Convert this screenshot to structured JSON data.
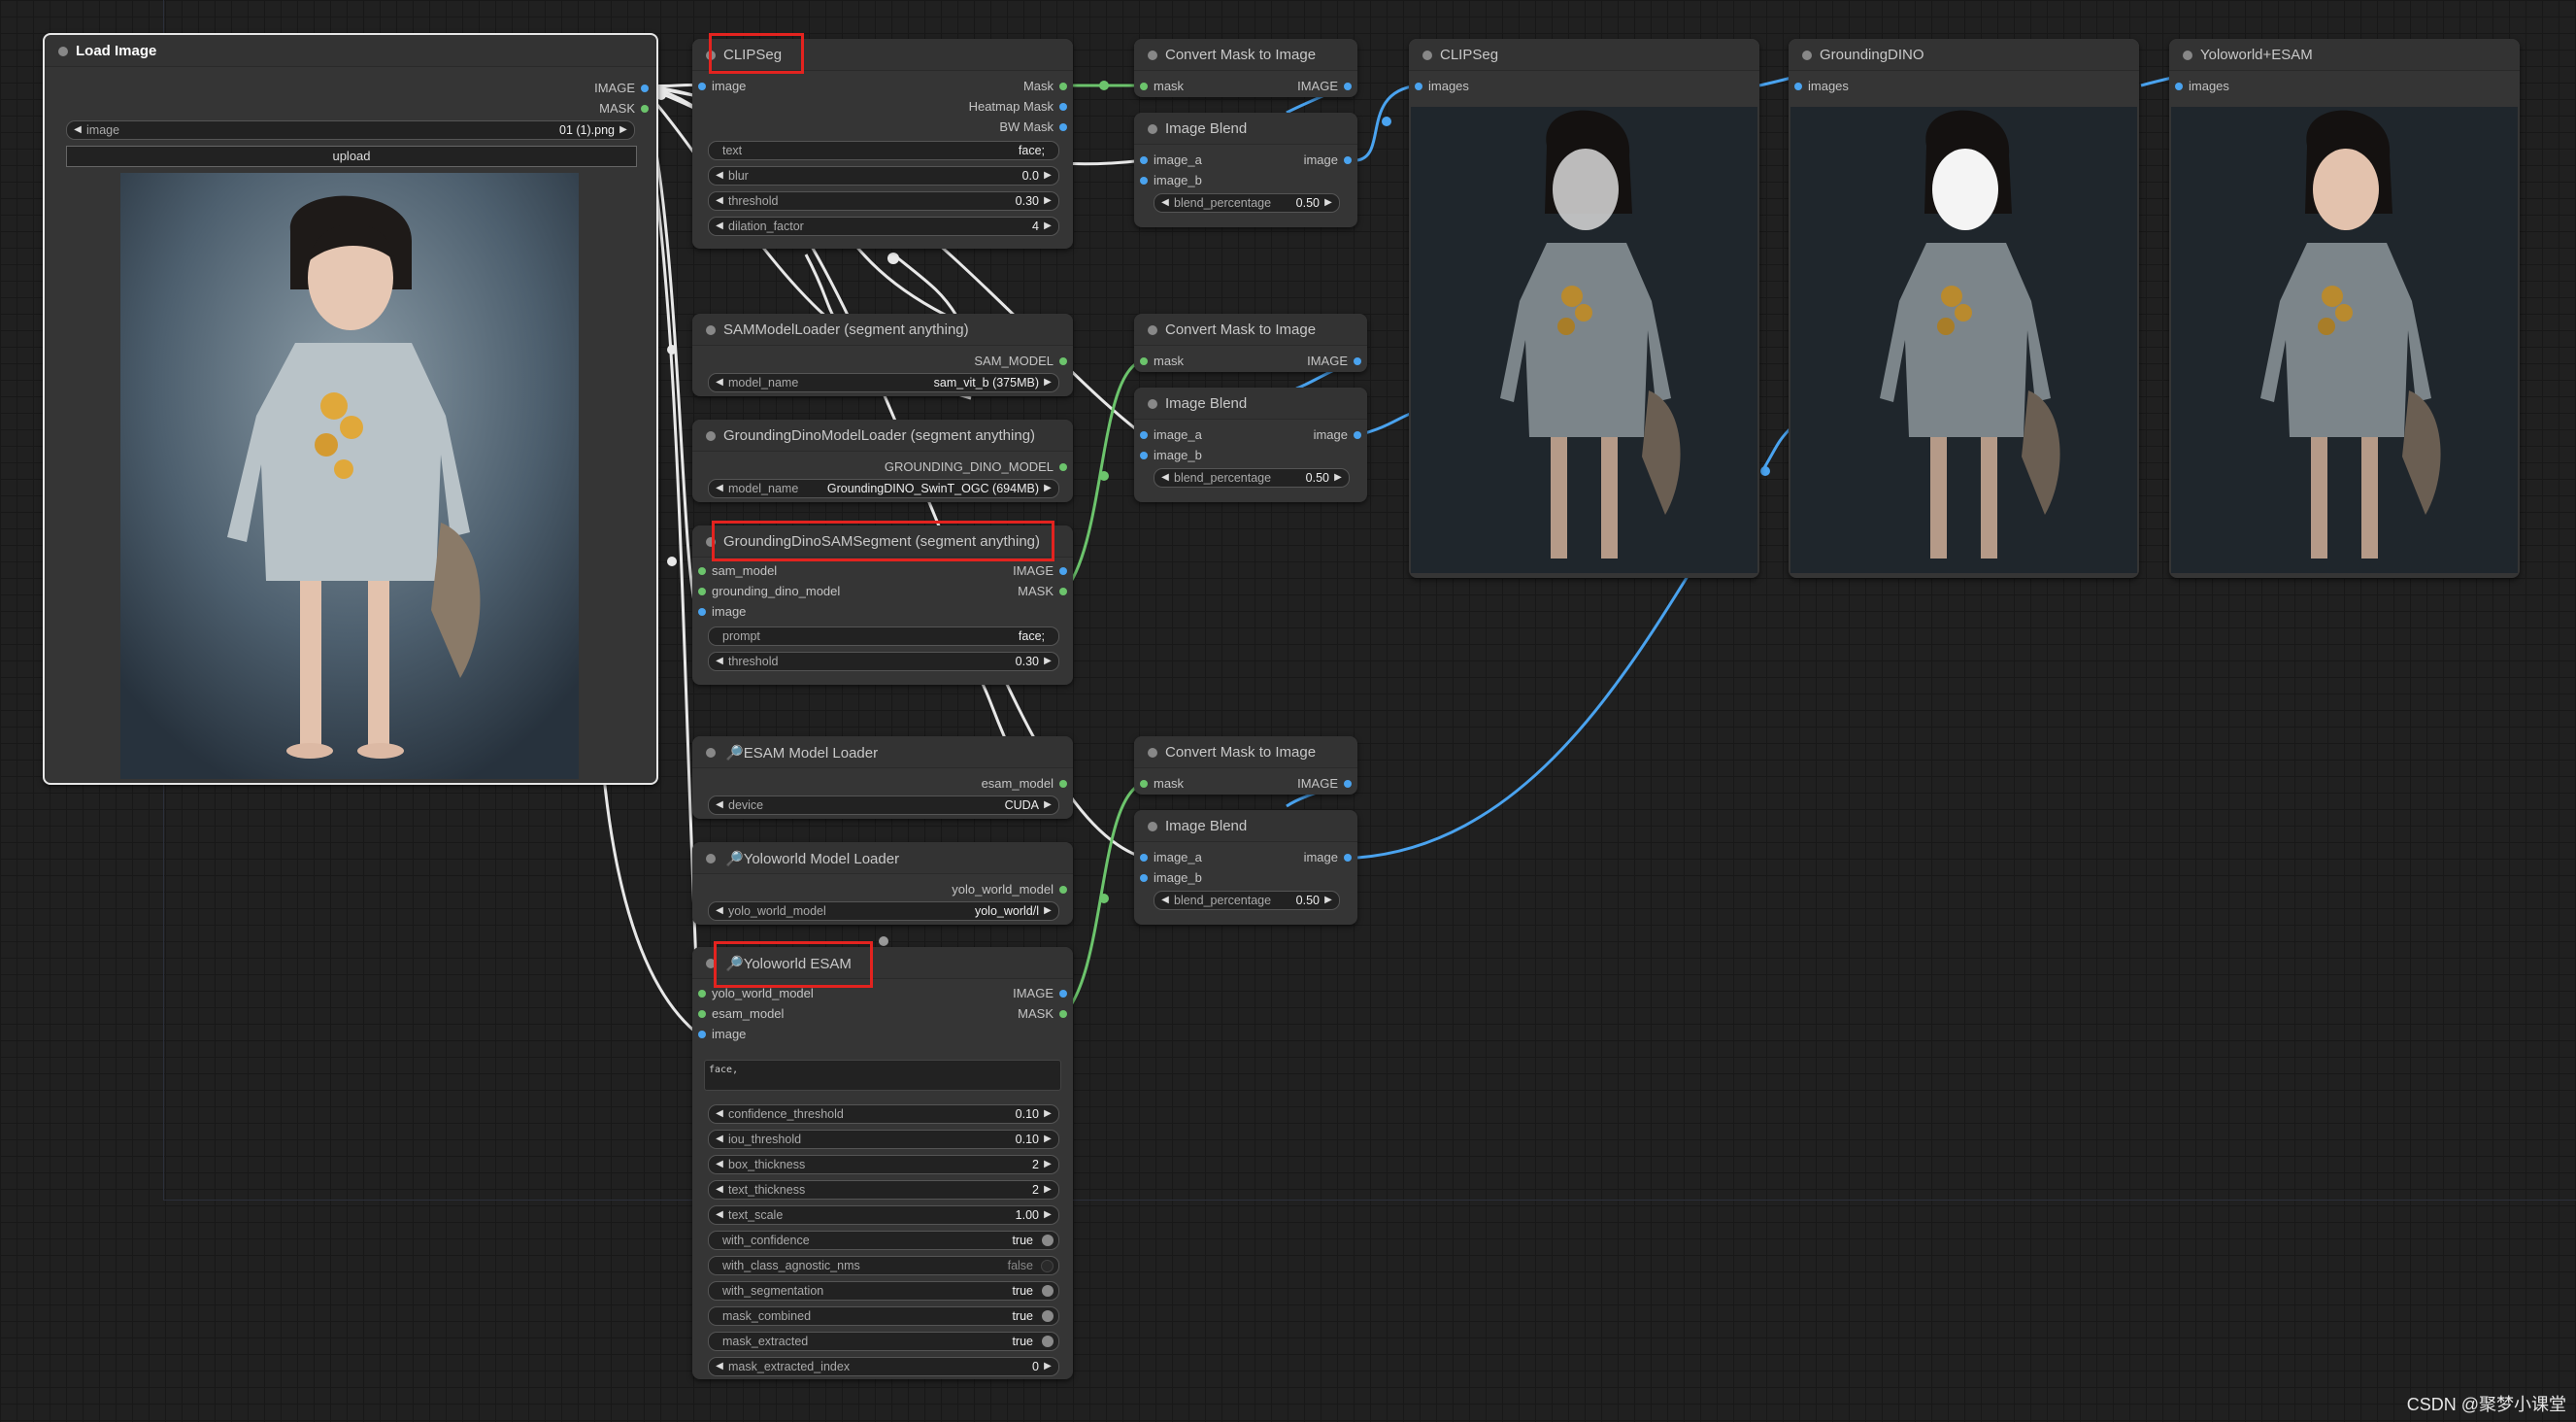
{
  "nodes": {
    "load_image": {
      "title": "Load Image",
      "outputs": [
        "IMAGE",
        "MASK"
      ],
      "image_label": "image",
      "image_value": "01 (1).png",
      "upload_label": "upload"
    },
    "clipseg": {
      "title": "CLIPSeg",
      "input": "image",
      "outputs": [
        "Mask",
        "Heatmap Mask",
        "BW Mask"
      ],
      "widgets": [
        {
          "label": "text",
          "value": "face;"
        },
        {
          "label": "blur",
          "value": "0.0"
        },
        {
          "label": "threshold",
          "value": "0.30"
        },
        {
          "label": "dilation_factor",
          "value": "4"
        }
      ]
    },
    "sam_loader": {
      "title": "SAMModelLoader (segment anything)",
      "output": "SAM_MODEL",
      "widget": {
        "label": "model_name",
        "value": "sam_vit_b (375MB)"
      }
    },
    "dino_loader": {
      "title": "GroundingDinoModelLoader (segment anything)",
      "output": "GROUNDING_DINO_MODEL",
      "widget": {
        "label": "model_name",
        "value": "GroundingDINO_SwinT_OGC (694MB)"
      }
    },
    "dino_sam": {
      "title": "GroundingDinoSAMSegment (segment anything)",
      "inputs": [
        "sam_model",
        "grounding_dino_model",
        "image"
      ],
      "outputs": [
        "IMAGE",
        "MASK"
      ],
      "widgets": [
        {
          "label": "prompt",
          "value": "face;"
        },
        {
          "label": "threshold",
          "value": "0.30"
        }
      ]
    },
    "esam_loader": {
      "title": "ESAM Model Loader",
      "output": "esam_model",
      "widget": {
        "label": "device",
        "value": "CUDA"
      }
    },
    "yolo_loader": {
      "title": "Yoloworld Model Loader",
      "output": "yolo_world_model",
      "widget": {
        "label": "yolo_world_model",
        "value": "yolo_world/l"
      }
    },
    "yolo_esam": {
      "title": "Yoloworld ESAM",
      "inputs": [
        "yolo_world_model",
        "esam_model",
        "image"
      ],
      "outputs": [
        "IMAGE",
        "MASK"
      ],
      "text": "face,",
      "widgets": [
        {
          "label": "confidence_threshold",
          "value": "0.10"
        },
        {
          "label": "iou_threshold",
          "value": "0.10"
        },
        {
          "label": "box_thickness",
          "value": "2"
        },
        {
          "label": "text_thickness",
          "value": "2"
        },
        {
          "label": "text_scale",
          "value": "1.00"
        }
      ],
      "toggles": [
        {
          "label": "with_confidence",
          "value": "true",
          "on": true
        },
        {
          "label": "with_class_agnostic_nms",
          "value": "false",
          "on": false
        },
        {
          "label": "with_segmentation",
          "value": "true",
          "on": true
        },
        {
          "label": "mask_combined",
          "value": "true",
          "on": true
        },
        {
          "label": "mask_extracted",
          "value": "true",
          "on": true
        }
      ],
      "last_widget": {
        "label": "mask_extracted_index",
        "value": "0"
      }
    },
    "convert_1": {
      "title": "Convert Mask to Image",
      "input": "mask",
      "output": "IMAGE"
    },
    "blend_1": {
      "title": "Image Blend",
      "inputs": [
        "image_a",
        "image_b"
      ],
      "output": "image",
      "widget": {
        "label": "blend_percentage",
        "value": "0.50"
      }
    },
    "convert_2": {
      "title": "Convert Mask to Image",
      "input": "mask",
      "output": "IMAGE"
    },
    "blend_2": {
      "title": "Image Blend",
      "inputs": [
        "image_a",
        "image_b"
      ],
      "output": "image",
      "widget": {
        "label": "blend_percentage",
        "value": "0.50"
      }
    },
    "convert_3": {
      "title": "Convert Mask to Image",
      "input": "mask",
      "output": "IMAGE"
    },
    "blend_3": {
      "title": "Image Blend",
      "inputs": [
        "image_a",
        "image_b"
      ],
      "output": "image",
      "widget": {
        "label": "blend_percentage",
        "value": "0.50"
      }
    },
    "preview_clipseg": {
      "title": "CLIPSeg",
      "input": "images"
    },
    "preview_dino": {
      "title": "GroundingDINO",
      "input": "images"
    },
    "preview_yolo": {
      "title": "Yoloworld+ESAM",
      "input": "images"
    }
  },
  "watermark": "CSDN @聚梦小课堂",
  "colors": {
    "canvas": "#202020",
    "node": "#353535",
    "image_wire": "#4aa3ef",
    "mask_wire": "#6cc46c",
    "highlight": "#e3231f"
  }
}
